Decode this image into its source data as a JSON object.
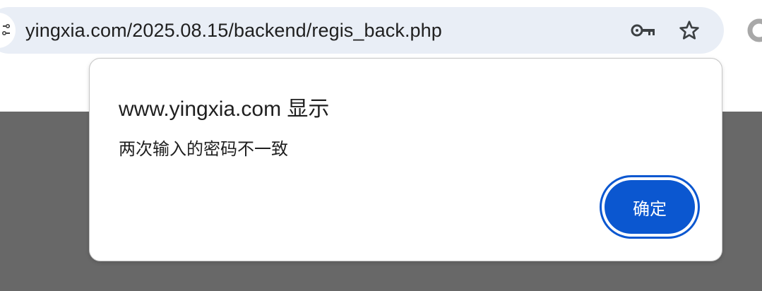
{
  "address_bar": {
    "url": "yingxia.com/2025.08.15/backend/regis_back.php",
    "icons": [
      "site-info-icon",
      "key-icon",
      "star-icon",
      "extension-icon"
    ]
  },
  "dialog": {
    "title": "www.yingxia.com 显示",
    "message": "两次输入的密码不一致",
    "ok_label": "确定"
  },
  "colors": {
    "omnibox_bg": "#e9eef6",
    "page_dim": "#686868",
    "accent": "#0b57d0"
  }
}
